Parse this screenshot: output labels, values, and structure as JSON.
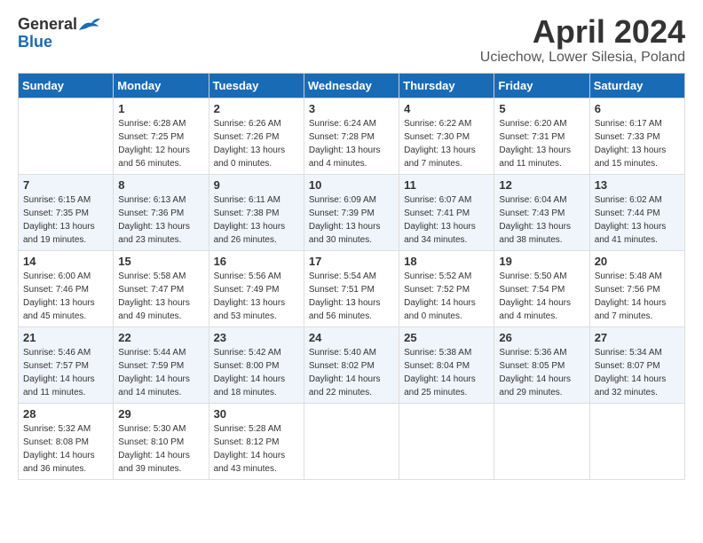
{
  "header": {
    "logo_general": "General",
    "logo_blue": "Blue",
    "title": "April 2024",
    "subtitle": "Uciechow, Lower Silesia, Poland"
  },
  "weekdays": [
    "Sunday",
    "Monday",
    "Tuesday",
    "Wednesday",
    "Thursday",
    "Friday",
    "Saturday"
  ],
  "weeks": [
    [
      {
        "day": "",
        "sunrise": "",
        "sunset": "",
        "daylight": ""
      },
      {
        "day": "1",
        "sunrise": "Sunrise: 6:28 AM",
        "sunset": "Sunset: 7:25 PM",
        "daylight": "Daylight: 12 hours and 56 minutes."
      },
      {
        "day": "2",
        "sunrise": "Sunrise: 6:26 AM",
        "sunset": "Sunset: 7:26 PM",
        "daylight": "Daylight: 13 hours and 0 minutes."
      },
      {
        "day": "3",
        "sunrise": "Sunrise: 6:24 AM",
        "sunset": "Sunset: 7:28 PM",
        "daylight": "Daylight: 13 hours and 4 minutes."
      },
      {
        "day": "4",
        "sunrise": "Sunrise: 6:22 AM",
        "sunset": "Sunset: 7:30 PM",
        "daylight": "Daylight: 13 hours and 7 minutes."
      },
      {
        "day": "5",
        "sunrise": "Sunrise: 6:20 AM",
        "sunset": "Sunset: 7:31 PM",
        "daylight": "Daylight: 13 hours and 11 minutes."
      },
      {
        "day": "6",
        "sunrise": "Sunrise: 6:17 AM",
        "sunset": "Sunset: 7:33 PM",
        "daylight": "Daylight: 13 hours and 15 minutes."
      }
    ],
    [
      {
        "day": "7",
        "sunrise": "Sunrise: 6:15 AM",
        "sunset": "Sunset: 7:35 PM",
        "daylight": "Daylight: 13 hours and 19 minutes."
      },
      {
        "day": "8",
        "sunrise": "Sunrise: 6:13 AM",
        "sunset": "Sunset: 7:36 PM",
        "daylight": "Daylight: 13 hours and 23 minutes."
      },
      {
        "day": "9",
        "sunrise": "Sunrise: 6:11 AM",
        "sunset": "Sunset: 7:38 PM",
        "daylight": "Daylight: 13 hours and 26 minutes."
      },
      {
        "day": "10",
        "sunrise": "Sunrise: 6:09 AM",
        "sunset": "Sunset: 7:39 PM",
        "daylight": "Daylight: 13 hours and 30 minutes."
      },
      {
        "day": "11",
        "sunrise": "Sunrise: 6:07 AM",
        "sunset": "Sunset: 7:41 PM",
        "daylight": "Daylight: 13 hours and 34 minutes."
      },
      {
        "day": "12",
        "sunrise": "Sunrise: 6:04 AM",
        "sunset": "Sunset: 7:43 PM",
        "daylight": "Daylight: 13 hours and 38 minutes."
      },
      {
        "day": "13",
        "sunrise": "Sunrise: 6:02 AM",
        "sunset": "Sunset: 7:44 PM",
        "daylight": "Daylight: 13 hours and 41 minutes."
      }
    ],
    [
      {
        "day": "14",
        "sunrise": "Sunrise: 6:00 AM",
        "sunset": "Sunset: 7:46 PM",
        "daylight": "Daylight: 13 hours and 45 minutes."
      },
      {
        "day": "15",
        "sunrise": "Sunrise: 5:58 AM",
        "sunset": "Sunset: 7:47 PM",
        "daylight": "Daylight: 13 hours and 49 minutes."
      },
      {
        "day": "16",
        "sunrise": "Sunrise: 5:56 AM",
        "sunset": "Sunset: 7:49 PM",
        "daylight": "Daylight: 13 hours and 53 minutes."
      },
      {
        "day": "17",
        "sunrise": "Sunrise: 5:54 AM",
        "sunset": "Sunset: 7:51 PM",
        "daylight": "Daylight: 13 hours and 56 minutes."
      },
      {
        "day": "18",
        "sunrise": "Sunrise: 5:52 AM",
        "sunset": "Sunset: 7:52 PM",
        "daylight": "Daylight: 14 hours and 0 minutes."
      },
      {
        "day": "19",
        "sunrise": "Sunrise: 5:50 AM",
        "sunset": "Sunset: 7:54 PM",
        "daylight": "Daylight: 14 hours and 4 minutes."
      },
      {
        "day": "20",
        "sunrise": "Sunrise: 5:48 AM",
        "sunset": "Sunset: 7:56 PM",
        "daylight": "Daylight: 14 hours and 7 minutes."
      }
    ],
    [
      {
        "day": "21",
        "sunrise": "Sunrise: 5:46 AM",
        "sunset": "Sunset: 7:57 PM",
        "daylight": "Daylight: 14 hours and 11 minutes."
      },
      {
        "day": "22",
        "sunrise": "Sunrise: 5:44 AM",
        "sunset": "Sunset: 7:59 PM",
        "daylight": "Daylight: 14 hours and 14 minutes."
      },
      {
        "day": "23",
        "sunrise": "Sunrise: 5:42 AM",
        "sunset": "Sunset: 8:00 PM",
        "daylight": "Daylight: 14 hours and 18 minutes."
      },
      {
        "day": "24",
        "sunrise": "Sunrise: 5:40 AM",
        "sunset": "Sunset: 8:02 PM",
        "daylight": "Daylight: 14 hours and 22 minutes."
      },
      {
        "day": "25",
        "sunrise": "Sunrise: 5:38 AM",
        "sunset": "Sunset: 8:04 PM",
        "daylight": "Daylight: 14 hours and 25 minutes."
      },
      {
        "day": "26",
        "sunrise": "Sunrise: 5:36 AM",
        "sunset": "Sunset: 8:05 PM",
        "daylight": "Daylight: 14 hours and 29 minutes."
      },
      {
        "day": "27",
        "sunrise": "Sunrise: 5:34 AM",
        "sunset": "Sunset: 8:07 PM",
        "daylight": "Daylight: 14 hours and 32 minutes."
      }
    ],
    [
      {
        "day": "28",
        "sunrise": "Sunrise: 5:32 AM",
        "sunset": "Sunset: 8:08 PM",
        "daylight": "Daylight: 14 hours and 36 minutes."
      },
      {
        "day": "29",
        "sunrise": "Sunrise: 5:30 AM",
        "sunset": "Sunset: 8:10 PM",
        "daylight": "Daylight: 14 hours and 39 minutes."
      },
      {
        "day": "30",
        "sunrise": "Sunrise: 5:28 AM",
        "sunset": "Sunset: 8:12 PM",
        "daylight": "Daylight: 14 hours and 43 minutes."
      },
      {
        "day": "",
        "sunrise": "",
        "sunset": "",
        "daylight": ""
      },
      {
        "day": "",
        "sunrise": "",
        "sunset": "",
        "daylight": ""
      },
      {
        "day": "",
        "sunrise": "",
        "sunset": "",
        "daylight": ""
      },
      {
        "day": "",
        "sunrise": "",
        "sunset": "",
        "daylight": ""
      }
    ]
  ]
}
